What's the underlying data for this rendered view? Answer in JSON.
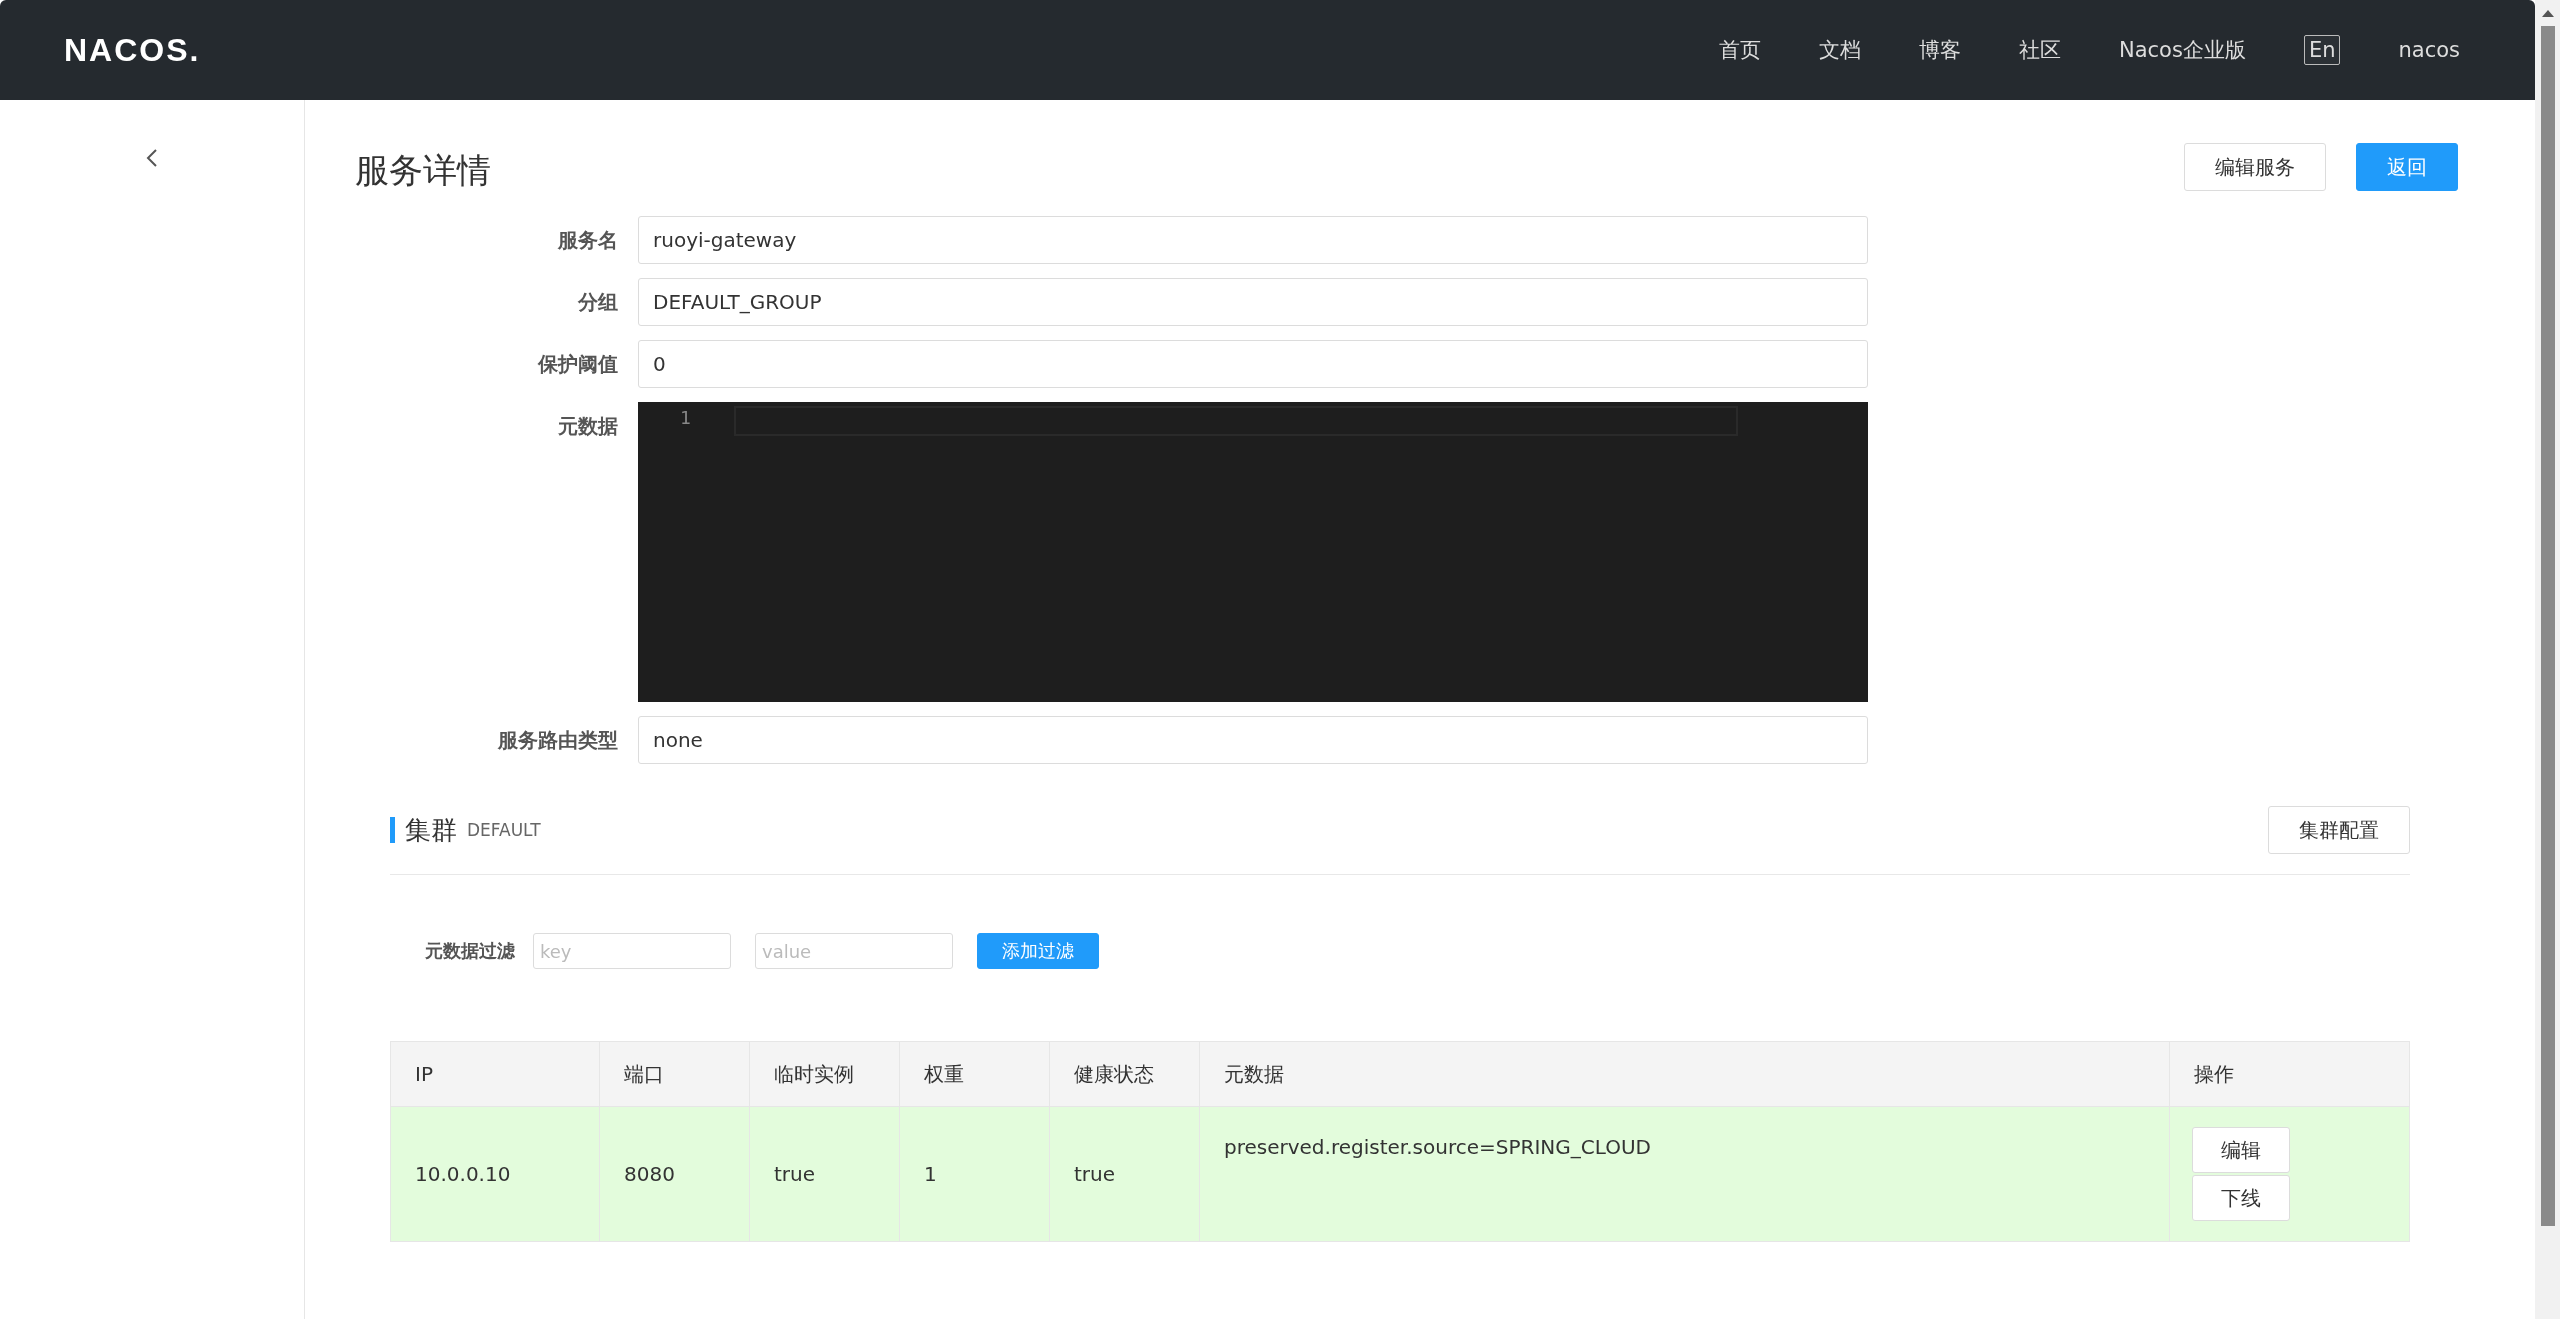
{
  "header": {
    "logo": "NACOS.",
    "nav": [
      {
        "label": "首页"
      },
      {
        "label": "文档"
      },
      {
        "label": "博客"
      },
      {
        "label": "社区"
      },
      {
        "label": "Nacos企业版"
      }
    ],
    "language": "En",
    "user": "nacos"
  },
  "page": {
    "title": "服务详情",
    "buttons": [
      {
        "label": "编辑服务",
        "kind": "default"
      },
      {
        "label": "返回",
        "kind": "primary"
      }
    ]
  },
  "form": {
    "fields": [
      {
        "label": "服务名",
        "value": "ruoyi-gateway",
        "kind": "input"
      },
      {
        "label": "分组",
        "value": "DEFAULT_GROUP",
        "kind": "input"
      },
      {
        "label": "保护阈值",
        "value": "0",
        "kind": "input"
      },
      {
        "label": "元数据",
        "line_number": "1",
        "kind": "editor"
      },
      {
        "label": "服务路由类型",
        "value": "none",
        "kind": "input"
      }
    ]
  },
  "cluster": {
    "title": "集群",
    "name": "DEFAULT",
    "config_button": "集群配置",
    "filter": {
      "label": "元数据过滤",
      "key_placeholder": "key",
      "value_placeholder": "value",
      "button": "添加过滤"
    },
    "table": {
      "columns": [
        "IP",
        "端口",
        "临时实例",
        "权重",
        "健康状态",
        "元数据",
        "操作"
      ],
      "rows": [
        {
          "ip": "10.0.0.10",
          "port": "8080",
          "ephemeral": "true",
          "weight": "1",
          "healthy": "true",
          "metadata": "preserved.register.source=SPRING_CLOUD",
          "actions": [
            "编辑",
            "下线"
          ]
        }
      ]
    }
  }
}
